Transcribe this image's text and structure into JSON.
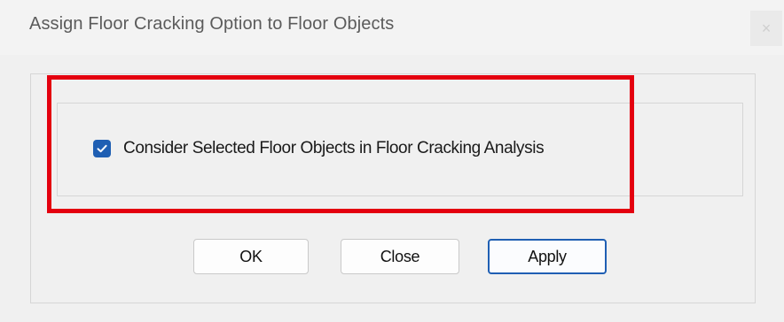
{
  "window": {
    "title": "Assign Floor Cracking Option to Floor Objects",
    "close_glyph": "×"
  },
  "option": {
    "checked": true,
    "label": "Consider Selected Floor Objects in Floor Cracking Analysis"
  },
  "buttons": {
    "ok_label": "OK",
    "close_label": "Close",
    "apply_label": "Apply"
  },
  "colors": {
    "accent": "#1f5fb3",
    "highlight": "#e4000f",
    "window_bg": "#f0f0f0"
  }
}
